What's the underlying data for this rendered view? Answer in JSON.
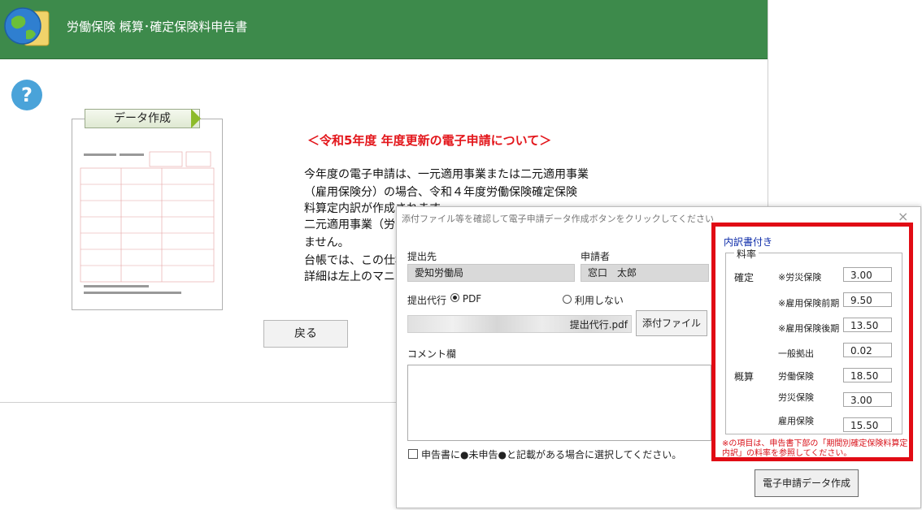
{
  "app": {
    "title": "労働保険 概算･確定保険料申告書",
    "data_create_button": "データ作成",
    "back_button": "戻る"
  },
  "notice": {
    "heading": "＜令和5年度 年度更新の電子申請について＞",
    "lines": [
      "今年度の電子申請は、一元適用事業または二元適用事業",
      "（雇用保険分）の場合、令和４年度労働保険確定保険",
      "料算定内訳が作成されます。",
      "二元適用事業（労",
      "ません。",
      "台帳では、この仕様",
      "詳細は左上のマニ"
    ]
  },
  "dialog": {
    "title": "添付ファイル等を確認して電子申請データ作成ボタンをクリックしてください",
    "close": "×",
    "submit_to_label": "提出先",
    "submit_to_value": "愛知労働局",
    "applicant_label": "申請者",
    "applicant_value": "窓口　太郎",
    "proxy_label": "提出代行",
    "proxy_pdf": "PDF",
    "proxy_none": "利用しない",
    "attach_path": "提出代行.pdf",
    "attach_button": "添付ファイル",
    "comment_label": "コメント欄",
    "checkbox_label": "申告書に●未申告●と記載がある場合に選択してください。",
    "create_button": "電子申請データ作成"
  },
  "rates": {
    "title": "内訳書付き",
    "group": "料率",
    "kakutei": "確定",
    "gaisan": "概算",
    "items": [
      {
        "label": "※労災保険",
        "value": "3.00"
      },
      {
        "label": "※雇用保険前期",
        "value": "9.50"
      },
      {
        "label": "※雇用保険後期",
        "value": "13.50"
      },
      {
        "label": "一般拠出",
        "value": "0.02"
      },
      {
        "label": "労働保険",
        "value": "18.50"
      },
      {
        "label": "労災保険",
        "value": "3.00"
      },
      {
        "label": "雇用保険",
        "value": "15.50"
      }
    ],
    "note": "※の項目は、申告書下部の「期間別確定保険料算定内訳」の料率を参照してください。"
  }
}
